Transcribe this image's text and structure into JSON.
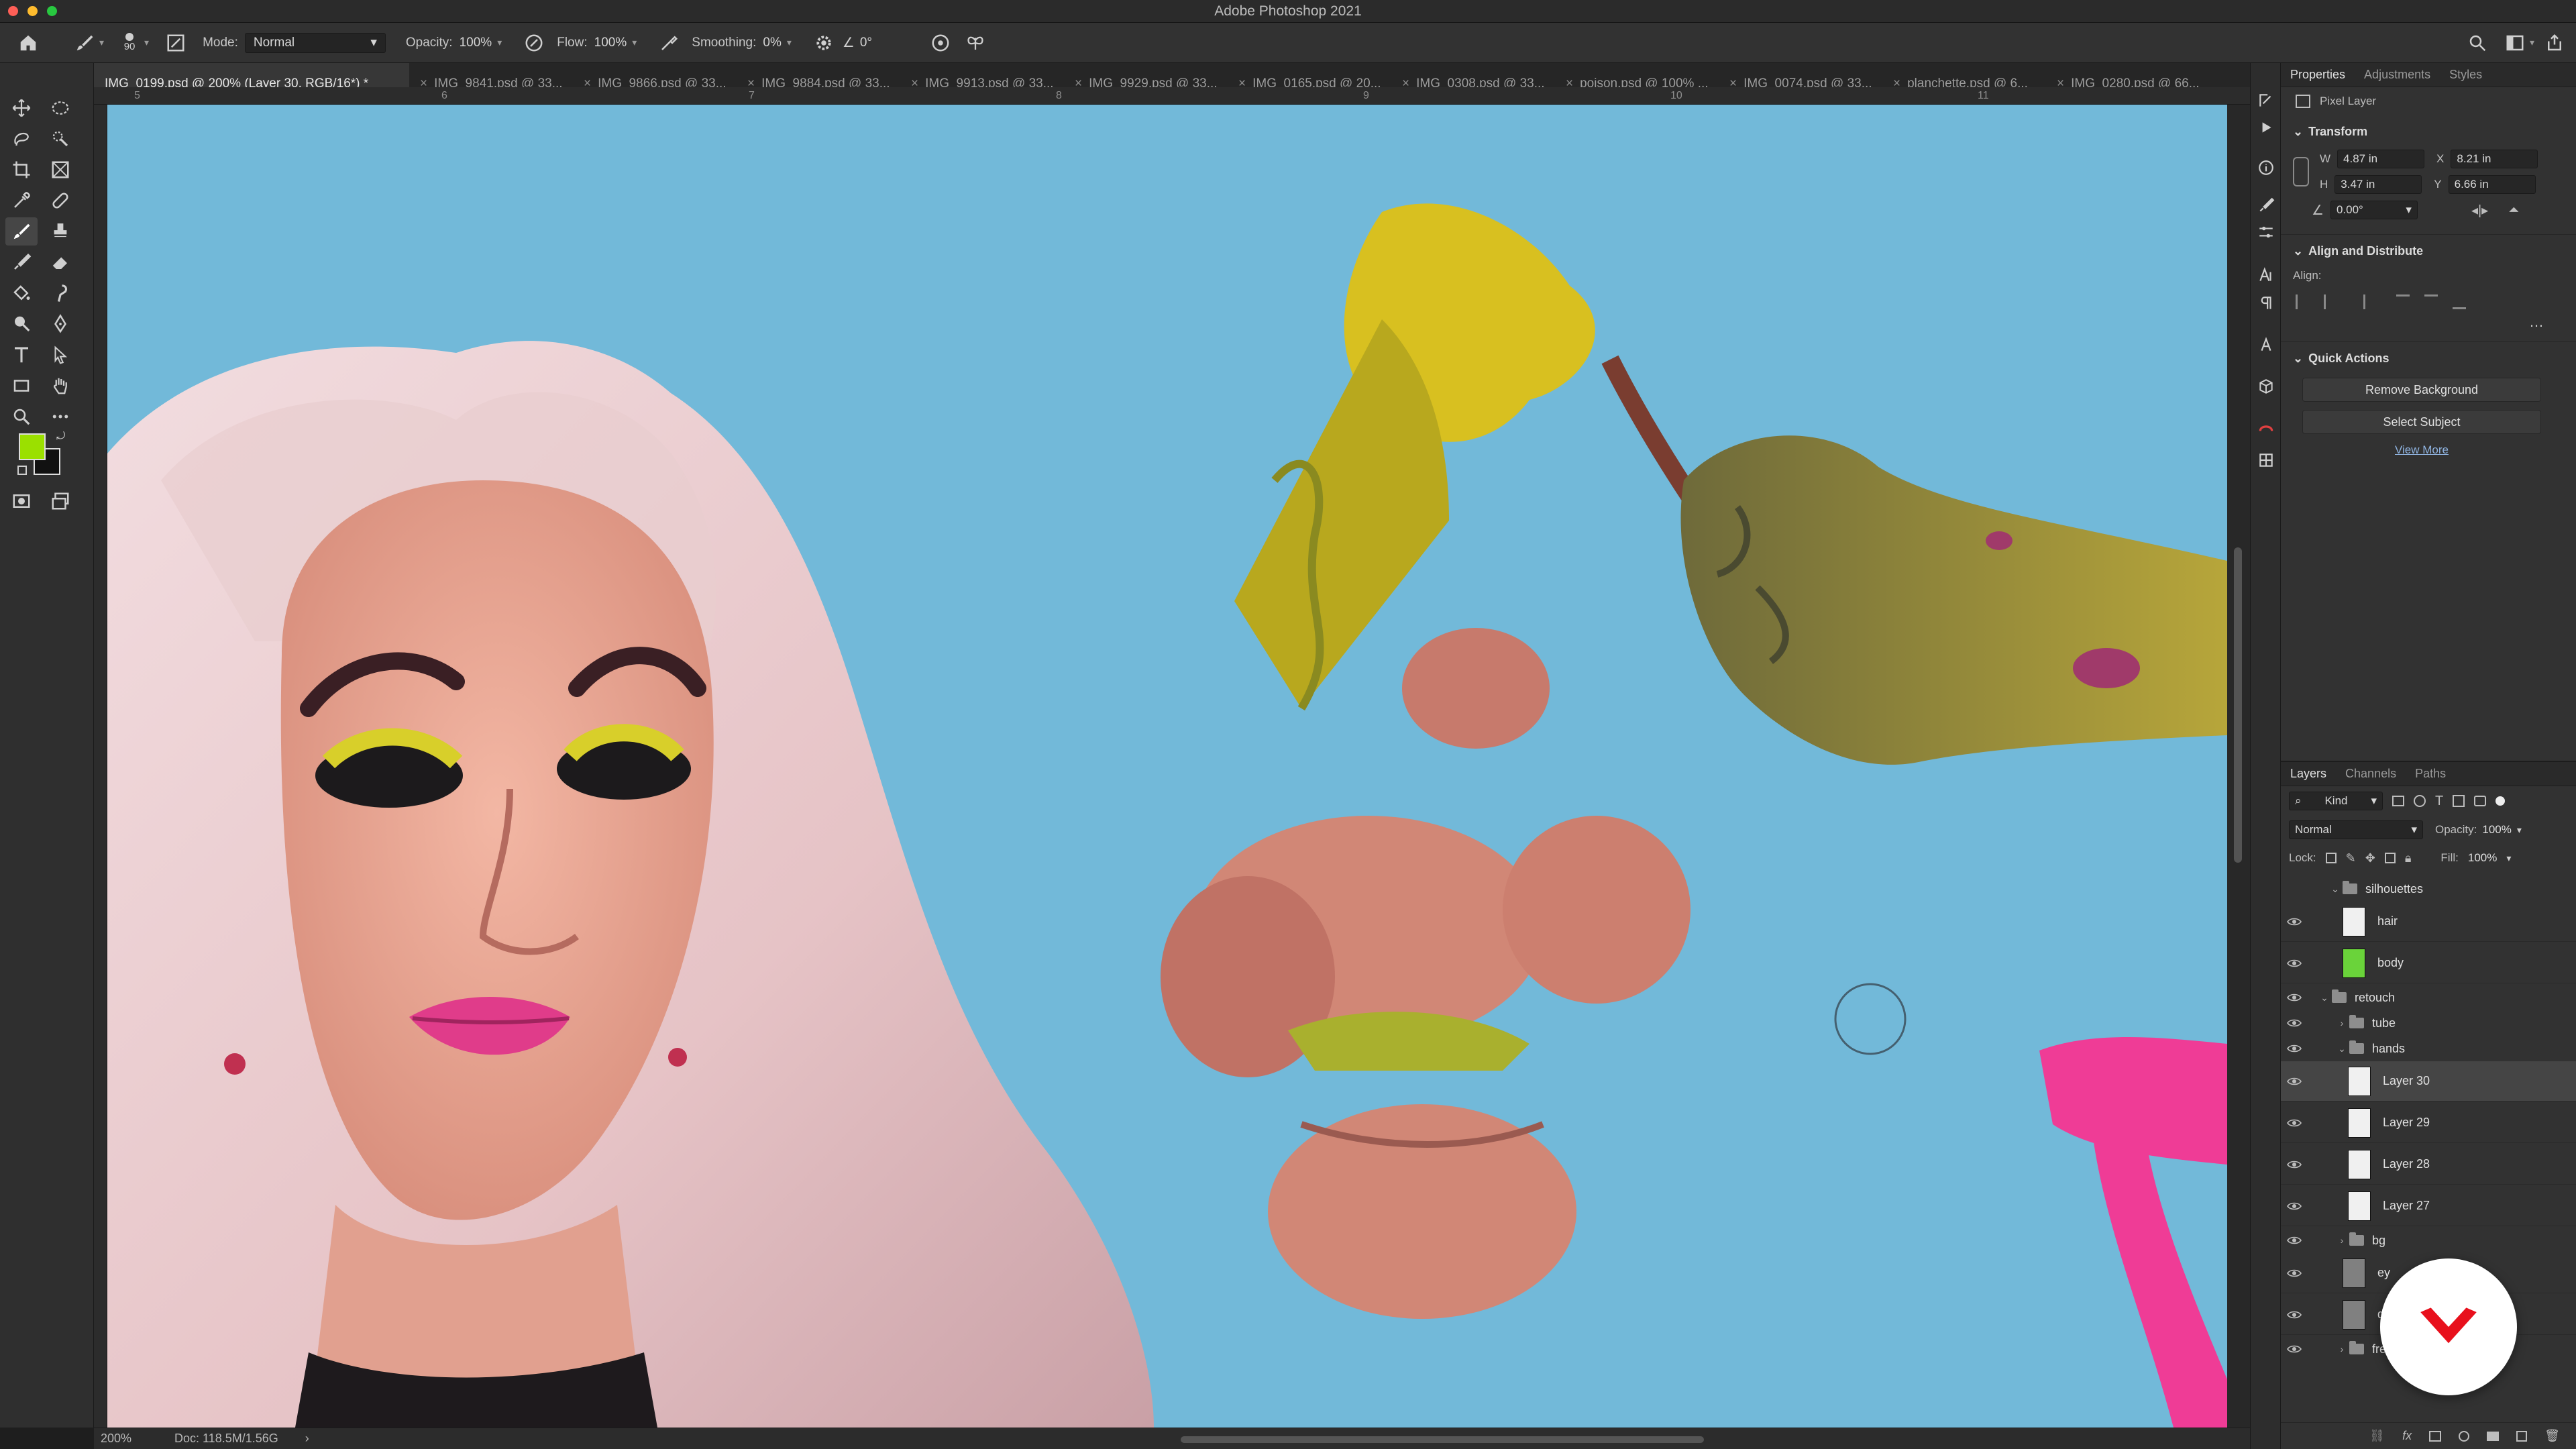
{
  "app": {
    "title": "Adobe Photoshop 2021"
  },
  "traffic": {
    "close": "#fe5f57",
    "minimize": "#febc2e",
    "maximize": "#28c840"
  },
  "options": {
    "brush_size": "90",
    "mode_label": "Mode:",
    "mode_value": "Normal",
    "opacity_label": "Opacity:",
    "opacity_value": "100%",
    "flow_label": "Flow:",
    "flow_value": "100%",
    "smoothing_label": "Smoothing:",
    "smoothing_value": "0%",
    "angle_value": "0°"
  },
  "tabs": [
    {
      "label": "IMG_0199.psd @ 200% (Layer 30, RGB/16*) *",
      "active": true
    },
    {
      "label": "IMG_9841.psd @ 33...",
      "active": false
    },
    {
      "label": "IMG_9866.psd @ 33...",
      "active": false
    },
    {
      "label": "IMG_9884.psd @ 33...",
      "active": false
    },
    {
      "label": "IMG_9913.psd @ 33...",
      "active": false
    },
    {
      "label": "IMG_9929.psd @ 33...",
      "active": false
    },
    {
      "label": "IMG_0165.psd @ 20...",
      "active": false
    },
    {
      "label": "IMG_0308.psd @ 33...",
      "active": false
    },
    {
      "label": "poison.psd @ 100% ...",
      "active": false
    },
    {
      "label": "IMG_0074.psd @ 33...",
      "active": false
    },
    {
      "label": "planchette.psd @ 6...",
      "active": false
    },
    {
      "label": "IMG_0280.psd @ 66...",
      "active": false
    }
  ],
  "ruler": {
    "ticks": [
      "5",
      "6",
      "7",
      "8",
      "9",
      "10",
      "11"
    ]
  },
  "colors": {
    "foreground": "#9be000",
    "background": "#111111",
    "canvas_bg": "#72b9d9"
  },
  "status": {
    "zoom": "200%",
    "doc": "Doc: 118.5M/1.56G"
  },
  "properties": {
    "tabs": [
      "Properties",
      "Adjustments",
      "Styles"
    ],
    "layer_type": "Pixel Layer",
    "transform_title": "Transform",
    "w_label": "W",
    "w_value": "4.87 in",
    "x_label": "X",
    "x_value": "8.21 in",
    "h_label": "H",
    "h_value": "3.47 in",
    "y_label": "Y",
    "y_value": "6.66 in",
    "angle_value": "0.00°",
    "align_title": "Align and Distribute",
    "align_label": "Align:",
    "quick_title": "Quick Actions",
    "remove_bg": "Remove Background",
    "select_subject": "Select Subject",
    "view_more": "View More"
  },
  "layers_panel": {
    "tabs": [
      "Layers",
      "Channels",
      "Paths"
    ],
    "kind": "Kind",
    "blend": "Normal",
    "opacity_label": "Opacity:",
    "opacity_value": "100%",
    "lock_label": "Lock:",
    "fill_label": "Fill:",
    "fill_value": "100%",
    "rows": [
      {
        "name": "silhouettes",
        "type": "group"
      },
      {
        "name": "hair",
        "type": "layer"
      },
      {
        "name": "body",
        "type": "layer"
      },
      {
        "name": "retouch",
        "type": "group"
      },
      {
        "name": "tube",
        "type": "group"
      },
      {
        "name": "hands",
        "type": "group"
      },
      {
        "name": "Layer 30",
        "type": "layer",
        "selected": true
      },
      {
        "name": "Layer 29",
        "type": "layer"
      },
      {
        "name": "Layer 28",
        "type": "layer"
      },
      {
        "name": "Layer 27",
        "type": "layer"
      },
      {
        "name": "bg",
        "type": "group"
      },
      {
        "name": "ey",
        "type": "layer"
      },
      {
        "name": "dodg",
        "type": "layer"
      },
      {
        "name": "frequency separation",
        "type": "group"
      }
    ]
  }
}
